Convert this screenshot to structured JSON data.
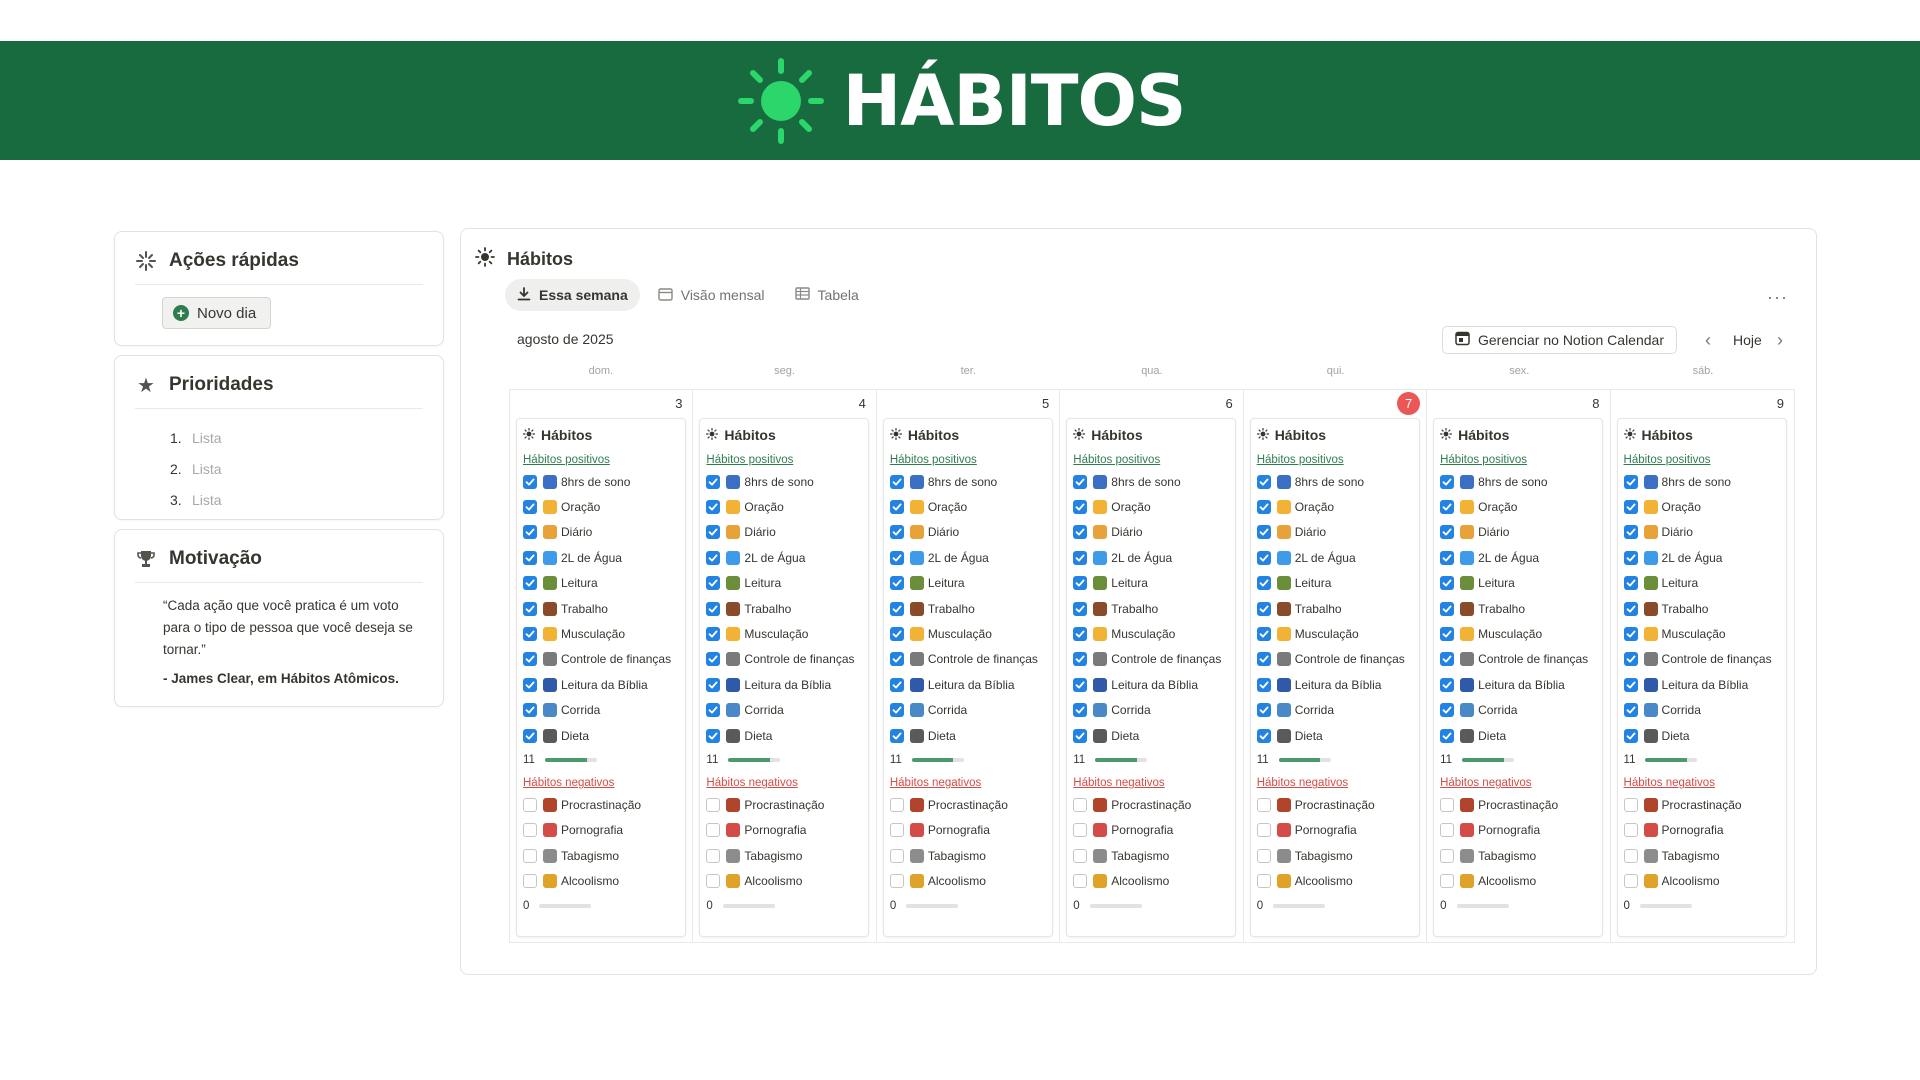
{
  "banner": {
    "title": "HÁBITOS"
  },
  "acoes": {
    "title": "Ações rápidas",
    "button_label": "Novo dia"
  },
  "prioridades": {
    "title": "Prioridades",
    "items": [
      {
        "num": "1.",
        "text": "Lista"
      },
      {
        "num": "2.",
        "text": "Lista"
      },
      {
        "num": "3.",
        "text": "Lista"
      }
    ]
  },
  "motivacao": {
    "title": "Motivação",
    "quote": "“Cada ação que você pratica é um voto para o tipo de pessoa que você deseja se tornar.”",
    "author": "- James Clear, em Hábitos Atômicos."
  },
  "main": {
    "title": "Hábitos",
    "tabs": [
      {
        "label": "Essa semana",
        "active": true,
        "icon": "download-icon"
      },
      {
        "label": "Visão mensal",
        "active": false,
        "icon": "calendar-icon"
      },
      {
        "label": "Tabela",
        "active": false,
        "icon": "table-icon"
      }
    ],
    "more": "···",
    "month": "agosto de 2025",
    "notion_calendar_button": "Gerenciar no Notion Calendar",
    "today_button": "Hoje",
    "weekdays": [
      "dom.",
      "seg.",
      "ter.",
      "qua.",
      "qui.",
      "sex.",
      "sáb."
    ],
    "days": [
      {
        "num": "3",
        "today": false
      },
      {
        "num": "4",
        "today": false
      },
      {
        "num": "5",
        "today": false
      },
      {
        "num": "6",
        "today": false
      },
      {
        "num": "7",
        "today": true
      },
      {
        "num": "8",
        "today": false
      },
      {
        "num": "9",
        "today": false
      }
    ],
    "card_title": "Hábitos",
    "positive_label": "Hábitos positivos",
    "negative_label": "Hábitos negativos",
    "positive_habits": [
      {
        "label": "8hrs de sono",
        "icon": "sleep-icon",
        "color": "#3a6fc4"
      },
      {
        "label": "Oração",
        "icon": "praying-hands-icon",
        "color": "#f2b233"
      },
      {
        "label": "Diário",
        "icon": "writing-hand-icon",
        "color": "#e8a23a"
      },
      {
        "label": "2L de Água",
        "icon": "water-drop-icon",
        "color": "#3d9be9"
      },
      {
        "label": "Leitura",
        "icon": "book-icon",
        "color": "#6b8e3a"
      },
      {
        "label": "Trabalho",
        "icon": "briefcase-icon",
        "color": "#8a4b2a"
      },
      {
        "label": "Musculação",
        "icon": "flexed-bicep-icon",
        "color": "#f2b233"
      },
      {
        "label": "Controle de finanças",
        "icon": "bank-icon",
        "color": "#7a7a7a"
      },
      {
        "label": "Leitura da Bíblia",
        "icon": "bible-icon",
        "color": "#2f5aa8"
      },
      {
        "label": "Corrida",
        "icon": "running-shoe-icon",
        "color": "#4a89c8"
      },
      {
        "label": "Dieta",
        "icon": "dinner-icon",
        "color": "#5a5a5a"
      }
    ],
    "negative_habits": [
      {
        "label": "Procrastinação",
        "icon": "bed-icon",
        "color": "#b0452c"
      },
      {
        "label": "Pornografia",
        "icon": "no-18-icon",
        "color": "#d44c47"
      },
      {
        "label": "Tabagismo",
        "icon": "cigarette-icon",
        "color": "#8c8c8c"
      },
      {
        "label": "Alcoolismo",
        "icon": "beer-icon",
        "color": "#e0a32a"
      }
    ],
    "positive_count": "11",
    "positive_progress": 0.8,
    "negative_count": "0",
    "negative_progress": 0
  },
  "colors": {
    "banner": "#176b3f",
    "checkbox": "#2383e2",
    "positive": "#2f7d4f",
    "negative": "#d44c47",
    "today": "#eb5757"
  }
}
